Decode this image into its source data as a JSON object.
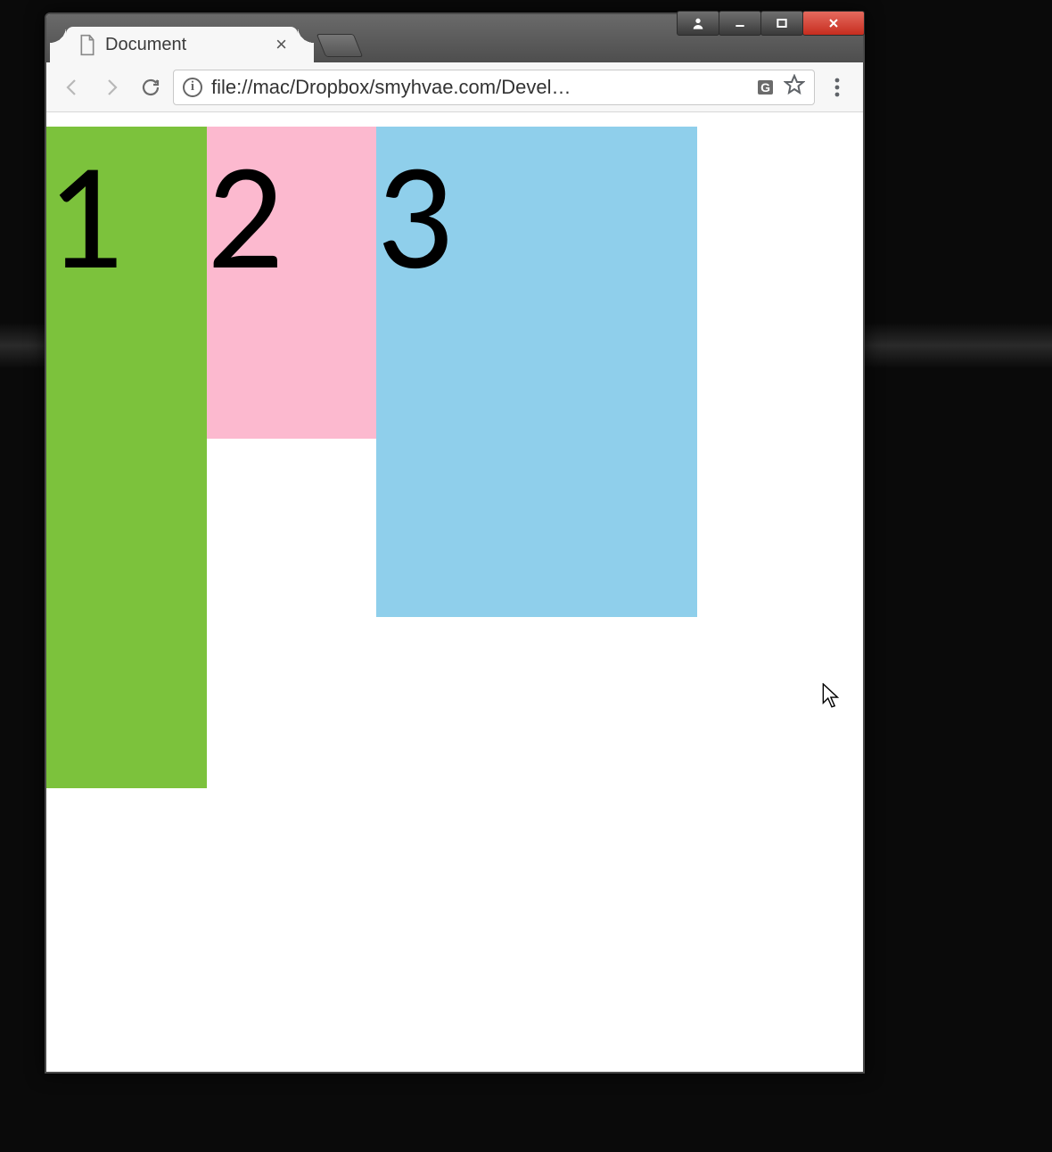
{
  "window": {
    "tab_title": "Document",
    "url_display": "file://mac/Dropbox/smyhvae.com/Devel…"
  },
  "icons": {
    "info_glyph": "i",
    "translate_glyph": "G",
    "close_glyph": "×"
  },
  "content": {
    "boxes": [
      {
        "label": "1",
        "color": "#7cc23c"
      },
      {
        "label": "2",
        "color": "#fcb9cf"
      },
      {
        "label": "3",
        "color": "#8fcfeb"
      }
    ]
  }
}
